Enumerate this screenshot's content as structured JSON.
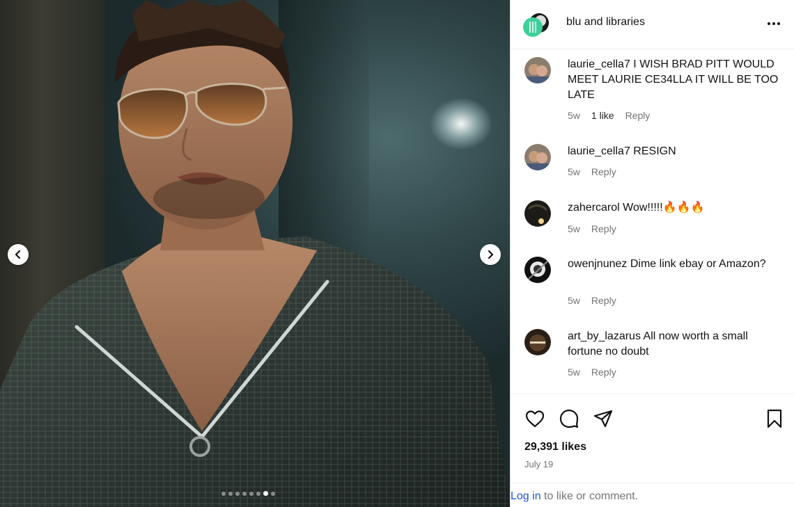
{
  "post": {
    "account": "blu and libraries",
    "likes": "29,391 likes",
    "date": "July 19",
    "carousel": {
      "total": 8,
      "active": 7
    }
  },
  "comments": [
    {
      "user": "laurie_cella7",
      "text": "I WISH BRAD PITT WOULD MEET LAURIE CE34LLA IT WILL BE TOO LATE",
      "time": "5w",
      "likes": "1 like",
      "reply": "Reply"
    },
    {
      "user": "laurie_cella7",
      "text": "RESIGN",
      "time": "5w",
      "likes": "",
      "reply": "Reply"
    },
    {
      "user": "zahercarol",
      "text": "Wow!!!!!🔥🔥🔥",
      "time": "5w",
      "likes": "",
      "reply": "Reply"
    },
    {
      "user": "owenjnunez",
      "text": "Dime link ebay or Amazon?",
      "time": "5w",
      "likes": "",
      "reply": "Reply"
    },
    {
      "user": "art_by_lazarus",
      "text": "All now worth a small fortune no doubt",
      "time": "5w",
      "likes": "",
      "reply": "Reply"
    }
  ],
  "login": {
    "link": "Log in",
    "rest": " to like or comment."
  },
  "icons": {
    "prev": "chevron-left-icon",
    "next": "chevron-right-icon",
    "more": "more-options-icon",
    "like": "heart-icon",
    "comment": "comment-icon",
    "share": "share-icon",
    "save": "bookmark-icon"
  },
  "colors": {
    "link": "#1a56db",
    "muted": "#737373"
  }
}
